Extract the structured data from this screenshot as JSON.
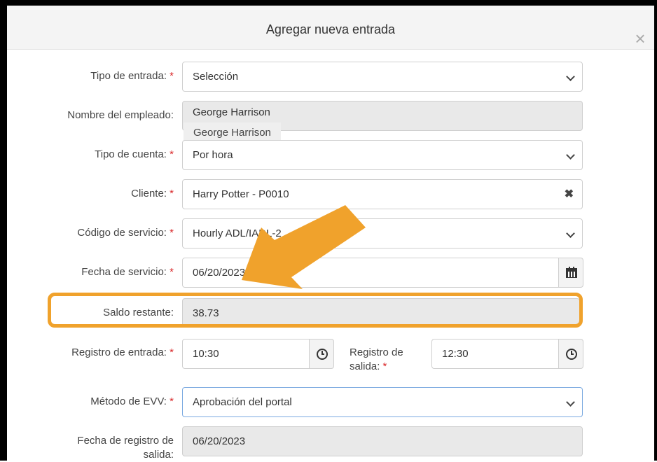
{
  "modal": {
    "title": "Agregar nueva entrada",
    "close_glyph": "×"
  },
  "required_marker": "*",
  "fields": {
    "entry_type": {
      "label": "Tipo de entrada:",
      "value": "Selección"
    },
    "employee_name": {
      "label": "Nombre del empleado:",
      "value": "George Harrison",
      "tooltip": "George Harrison"
    },
    "account_type": {
      "label": "Tipo de cuenta:",
      "value": "Por hora"
    },
    "client": {
      "label": "Cliente:",
      "value": "Harry Potter - P0010",
      "clear_glyph": "✖"
    },
    "service_code": {
      "label": "Código de servicio:",
      "value": "Hourly ADL/IADL-2"
    },
    "service_date": {
      "label": "Fecha de servicio:",
      "value": "06/20/2023"
    },
    "remaining_balance": {
      "label": "Saldo restante:",
      "value": "38.73"
    },
    "check_in": {
      "label": "Registro de entrada:",
      "value": "10:30"
    },
    "check_out": {
      "label_line1": "Registro de",
      "label_line2": "salida:",
      "value": "12:30"
    },
    "evv_method": {
      "label": "Método de EVV:",
      "value": "Aprobación del portal"
    },
    "checkout_date": {
      "label_line1": "Fecha de registro de",
      "label_line2": "salida:",
      "value": "06/20/2023"
    }
  },
  "icons": {
    "calendar": "calendar-icon",
    "clock": "clock-icon",
    "chevron": "chevron-down-icon",
    "clear": "clear-icon",
    "annotation_arrow": "arrow-icon"
  },
  "colors": {
    "highlight": "#f0a22c",
    "required": "#d9292b",
    "disabled_bg": "#e9e9e9",
    "header_bg": "#f4f4f4"
  }
}
